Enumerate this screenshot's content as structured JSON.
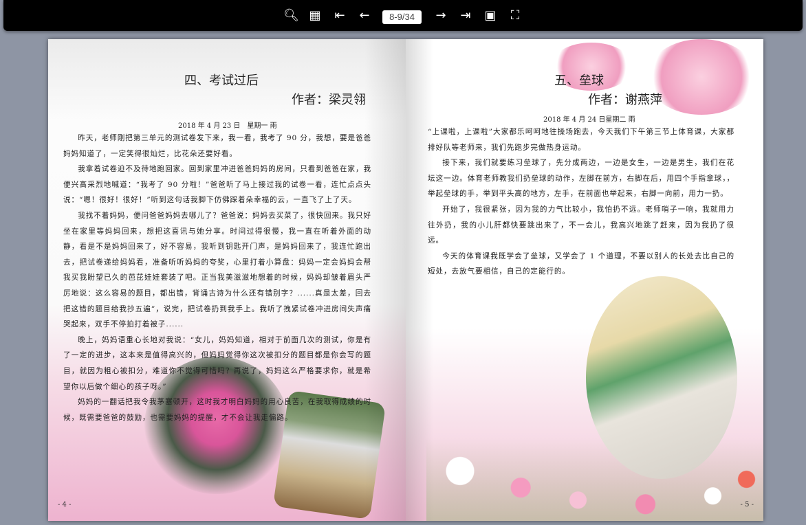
{
  "toolbar": {
    "zoom_icon": "zoom-in-icon",
    "thumbnails_icon": "grid-icon",
    "first_icon": "first-page-icon",
    "prev_icon": "arrow-left-icon",
    "page_indicator": "8-9/34",
    "next_icon": "arrow-right-icon",
    "last_icon": "last-page-icon",
    "autoplay_icon": "play-icon",
    "fullscreen_icon": "fullscreen-icon"
  },
  "left_page": {
    "title": "四、考试过后",
    "author": "作者：梁灵翎",
    "date": "2018 年 4 月 23 日　星期一 雨",
    "paragraphs": [
      "昨天，老师刚把第三单元的测试卷发下来，我一看，我考了 90 分，我想，要是爸爸妈妈知道了，一定笑得很灿烂，比花朵还要好看。",
      "我拿着试卷迫不及待地跑回家。回到家里冲进爸爸妈妈的房间，只看到爸爸在家，我便兴高采烈地喊道：“我考了 90 分啦！”爸爸听了马上接过我的试卷一看，连忙点点头说：“嗯！很好！很好！”听到这句话我脚下仿佛踩着朵幸福的云，一直飞了上了天。",
      "我找不着妈妈，便问爸爸妈妈去哪儿了？爸爸说：妈妈去买菜了，很快回来。我只好坐在家里等妈妈回来，想把这喜讯与她分享。时间过得很慢，我一直在听着外面的动静，看是不是妈妈回来了，好不容易，我听到钥匙开门声，是妈妈回来了，我连忙跑出去，把试卷递给妈妈看，准备听听妈妈的夸奖，心里打着小算盘：妈妈一定会妈妈会帮我买我盼望已久的芭芘娃娃套装了吧。正当我美滋滋地想着的时候，妈妈却皱着眉头严厉地说：这么容易的题目，都出错，背诵古诗为什么还有错别字？......真是太差，回去把这错的题目给我抄五遍”，说完，把试卷扔到我手上。我听了拽紧试卷冲进房间失声痛哭起来，双手不停拍打着被子......",
      "晚上，妈妈语重心长地对我说：“女儿，妈妈知道，相对于前面几次的测试，你是有了一定的进步，这本来是值得高兴的，但妈妈觉得你这次被扣分的题目都是你会写的题目，就因为粗心被扣分，难道你不觉得可惜吗？再说了，妈妈这么严格要求你，就是希望你以后做个细心的孩子呀。”",
      "妈妈的一翻话把我令我茅塞顿开，这时我才明白妈妈的用心良苦，在我取得成绩的时候，既需要爸爸的鼓励，也需要妈妈的提醒，才不会让我走偏路。"
    ],
    "page_number": "- 4 -"
  },
  "right_page": {
    "title": "五、垒球",
    "author": "作者：谢燕萍",
    "date": "2018 年 4 月 24 日星期二 雨",
    "paragraphs": [
      "“上课啦，上课啦”大家都乐呵呵地往操场跑去，今天我们下午第三节上体育课，大家都排好队等老师来，我们先跑步完做热身运动。",
      "接下来，我们就要练习垒球了，先分成两边，一边是女生，一边是男生，我们在花坛这一边。体育老师教我们扔垒球的动作，左脚在前方，右脚在后，用四个手指拿球，，举起垒球的手，举到平头高的地方，左手，在前面也举起来，右脚一向前，用力一扔。",
      "开始了，我很紧张，因为我的力气比较小，我怕扔不远。老师哨子一响，我就用力往外扔，我的小儿肝都快要跳出来了，不一会儿，我高兴地跳了赶来，因为我扔了很远。",
      "今天的体育课我既学会了垒球，又学会了 1 个道理，不要以别人的长处去比自己的短处，去放气要相信，自己的定能行的。"
    ],
    "page_number": "- 5 -"
  }
}
